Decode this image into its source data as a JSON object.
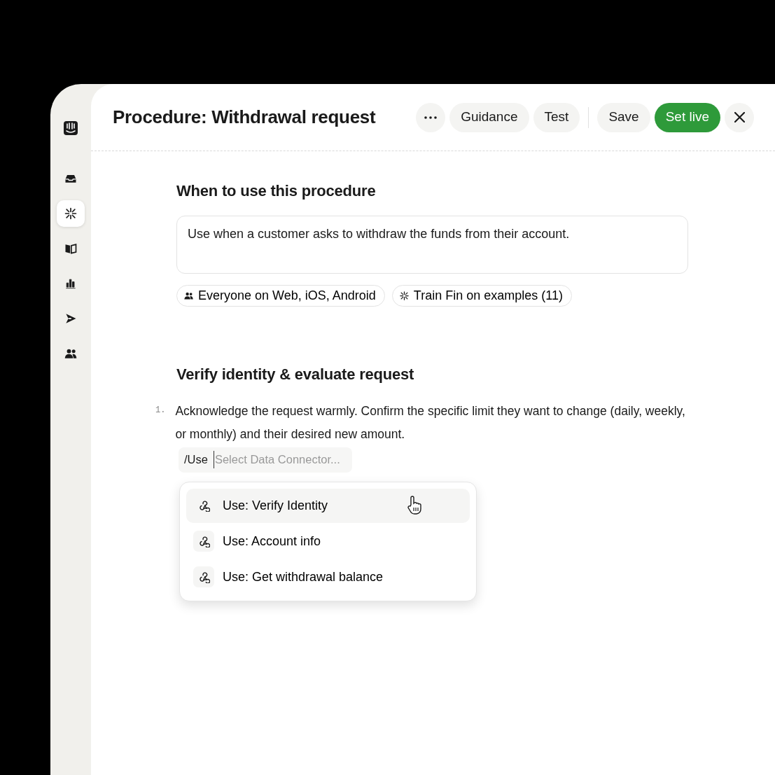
{
  "sidebar": {
    "items": [
      {
        "kind": "logo",
        "selected": false
      },
      {
        "kind": "inbox",
        "selected": false
      },
      {
        "kind": "fin",
        "selected": true
      },
      {
        "kind": "book",
        "selected": false
      },
      {
        "kind": "chart",
        "selected": false
      },
      {
        "kind": "send",
        "selected": false
      },
      {
        "kind": "people",
        "selected": false
      }
    ]
  },
  "header": {
    "title": "Procedure: Withdrawal request",
    "actions": [
      {
        "kind": "more"
      },
      {
        "kind": "secondary",
        "label": "Guidance"
      },
      {
        "kind": "secondary",
        "label": "Test"
      },
      {
        "kind": "divider"
      },
      {
        "kind": "secondary",
        "label": "Save"
      },
      {
        "kind": "primary",
        "label": "Set live"
      },
      {
        "kind": "close"
      }
    ]
  },
  "when_section": {
    "heading": "When to use this procedure",
    "description": "Use when a customer asks to withdraw the funds from their account.",
    "chips": [
      {
        "kind": "audience",
        "label": "Everyone on Web, iOS, Android"
      },
      {
        "kind": "training",
        "label": "Train Fin on examples (11)"
      }
    ]
  },
  "steps_section": {
    "heading": "Verify identity & evaluate request",
    "steps": [
      {
        "number": "1.",
        "text": "Acknowledge the request warmly. Confirm the specific limit they want to change (daily, weekly, or monthly) and their desired new amount."
      }
    ],
    "command": {
      "prefix": "/Use",
      "placeholder": "Select Data Connector..."
    },
    "menu": [
      {
        "label": "Use: Verify Identity",
        "selected": true
      },
      {
        "label": "Use: Account info",
        "selected": false
      },
      {
        "label": "Use: Get withdrawal balance",
        "selected": false
      }
    ]
  }
}
